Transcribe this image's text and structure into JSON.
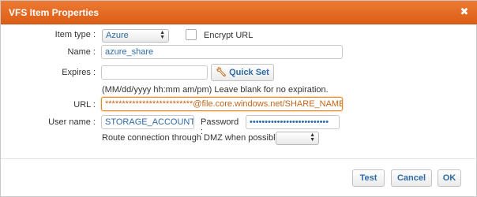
{
  "window": {
    "title": "VFS Item Properties"
  },
  "icons": {
    "close": "close-icon",
    "quick_set": "wrench-icon",
    "select_arrow": "up-down-arrow-icon"
  },
  "colors": {
    "titlebar": "#e36a22",
    "accent_text": "#2e6aa5",
    "focus_border": "#e28a2a"
  },
  "form": {
    "item_type": {
      "label": "Item type :",
      "value": "Azure"
    },
    "encrypt": {
      "label": "Encrypt URL",
      "checked": false
    },
    "name": {
      "label": "Name :",
      "value": "azure_share"
    },
    "expires": {
      "label": "Expires :",
      "value": "",
      "quick_set_label": "Quick Set",
      "hint": "(MM/dd/yyyy hh:mm am/pm) Leave blank for no expiration."
    },
    "url": {
      "label": "URL :",
      "value": "**************************@file.core.windows.net/SHARE_NAME/"
    },
    "username": {
      "label": "User name :",
      "value": "STORAGE_ACCOUNT_NA"
    },
    "password": {
      "label": "Password :",
      "value": "••••••••••••••••••••••••••"
    },
    "dmz": {
      "label": "Route connection through DMZ when possible :",
      "value": ""
    }
  },
  "buttons": {
    "test": "Test",
    "cancel": "Cancel",
    "ok": "OK"
  }
}
